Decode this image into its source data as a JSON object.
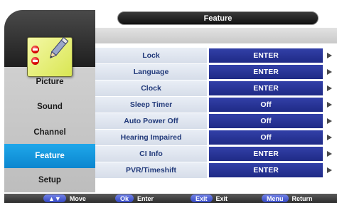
{
  "header": {
    "title": "Feature"
  },
  "sidebar": {
    "icon": "notepad-pencil-icon",
    "items": [
      {
        "label": "Picture"
      },
      {
        "label": "Sound"
      },
      {
        "label": "Channel"
      },
      {
        "label": "Feature",
        "active": true
      },
      {
        "label": "Setup"
      }
    ]
  },
  "options": [
    {
      "label": "Lock",
      "value": "ENTER"
    },
    {
      "label": "Language",
      "value": "ENTER"
    },
    {
      "label": "Clock",
      "value": "ENTER"
    },
    {
      "label": "Sleep Timer",
      "value": "Off"
    },
    {
      "label": "Auto Power Off",
      "value": "Off"
    },
    {
      "label": "Hearing Impaired",
      "value": "Off"
    },
    {
      "label": "CI Info",
      "value": "ENTER"
    },
    {
      "label": "PVR/Timeshift",
      "value": "ENTER"
    }
  ],
  "hints": [
    {
      "key": "▲▼",
      "action": "Move"
    },
    {
      "key": "Ok",
      "action": "Enter"
    },
    {
      "key": "Exit",
      "action": "Exit"
    },
    {
      "key": "Menu",
      "action": "Return"
    }
  ],
  "colors": {
    "accent_blue": "#0b86cf",
    "value_bar": "#1f2a86",
    "label_text": "#223a7a",
    "key_badge": "#3347c2"
  }
}
